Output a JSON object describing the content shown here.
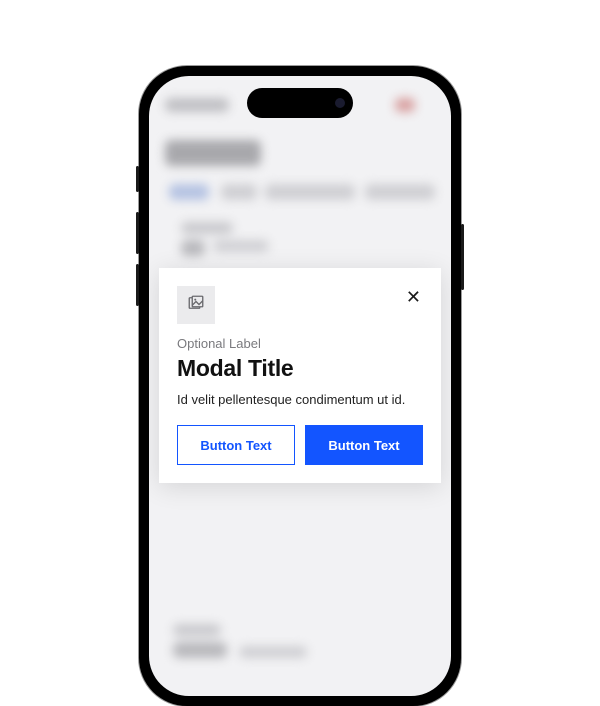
{
  "modal": {
    "label": "Optional Label",
    "title": "Modal Title",
    "body": "Id velit pellentesque condimentum ut id.",
    "secondary_button": "Button Text",
    "primary_button": "Button Text",
    "close_glyph": "✕"
  },
  "colors": {
    "primary": "#1355ff"
  }
}
